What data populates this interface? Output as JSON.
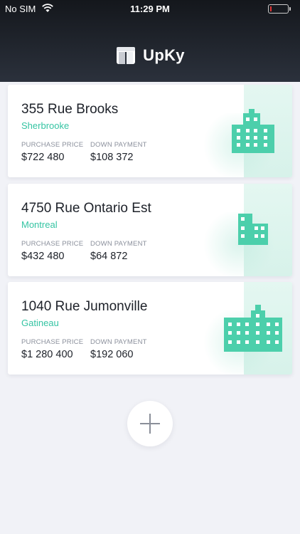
{
  "status_bar": {
    "carrier": "No SIM",
    "time": "11:29 PM"
  },
  "app": {
    "name": "UpKy"
  },
  "labels": {
    "purchase_price": "PURCHASE PRICE",
    "down_payment": "DOWN PAYMENT"
  },
  "properties": [
    {
      "address": "355 Rue Brooks",
      "city": "Sherbrooke",
      "purchase_price": "$722 480",
      "down_payment": "$108 372",
      "icon": "building-large-icon"
    },
    {
      "address": "4750 Rue Ontario Est",
      "city": "Montreal",
      "purchase_price": "$432 480",
      "down_payment": "$64 872",
      "icon": "building-small-icon"
    },
    {
      "address": "1040 Rue Jumonville",
      "city": "Gatineau",
      "purchase_price": "$1 280 400",
      "down_payment": "$192 060",
      "icon": "building-wide-icon"
    }
  ],
  "colors": {
    "accent": "#35c4a3",
    "building": "#4ccfab",
    "header": "#1f232b",
    "background": "#f1f2f7"
  }
}
